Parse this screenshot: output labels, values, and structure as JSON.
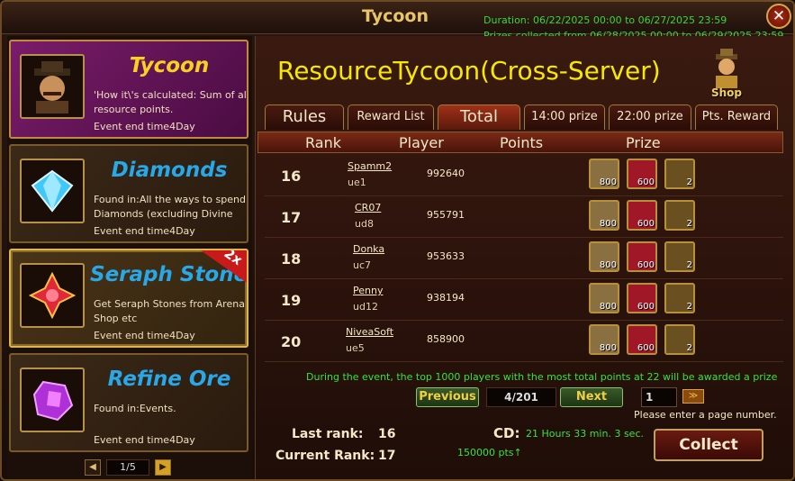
{
  "window": {
    "title": "Tycoon",
    "duration": "Duration: 06/22/2025 00:00 to 06/27/2025 23:59",
    "prizes_collected": "Prizes collected from 06/28/2025 00:00 to 06/29/2025 23:59",
    "close_label": "✕"
  },
  "sidebar": {
    "cards": [
      {
        "title": "Tycoon",
        "desc": "'How it\\'s calculated: Sum of all resource points.",
        "end": "Event end time4Day",
        "title_color": "#f8d020"
      },
      {
        "title": "Diamonds",
        "desc": "Found in:All the ways to spend Diamonds (excluding Divine",
        "end": "Event end time4Day",
        "title_color": "#28a8e8"
      },
      {
        "title": "Seraph Stones",
        "desc": "Get Seraph Stones from Arena Shop etc",
        "end": "Event end time4Day",
        "badge": "2x",
        "title_color": "#28a8e8"
      },
      {
        "title": "Refine Ore",
        "desc": "Found in:Events.",
        "end": "Event end time4Day",
        "title_color": "#28a8e8"
      }
    ],
    "pager": {
      "page": "1/5",
      "prev": "◀",
      "next": "▶"
    }
  },
  "main": {
    "title": "ResourceTycoon(Cross-Server)",
    "shop_label": "Shop",
    "tabs": [
      "Rules",
      "Reward List",
      "Total",
      "14:00 prize",
      "22:00 prize",
      "Pts. Reward"
    ],
    "columns": [
      "Rank",
      "Player",
      "Points",
      "Prize"
    ],
    "rows": [
      {
        "rank": "16",
        "name": "Spamm2",
        "server": "ue1",
        "points": "992640",
        "prizes": [
          "800",
          "600",
          "2"
        ]
      },
      {
        "rank": "17",
        "name": "CR07",
        "server": "ud8",
        "points": "955791",
        "prizes": [
          "800",
          "600",
          "2"
        ]
      },
      {
        "rank": "18",
        "name": "Donka",
        "server": "uc7",
        "points": "953633",
        "prizes": [
          "800",
          "600",
          "2"
        ]
      },
      {
        "rank": "19",
        "name": "Penny",
        "server": "ud12",
        "points": "938194",
        "prizes": [
          "800",
          "600",
          "2"
        ]
      },
      {
        "rank": "20",
        "name": "NiveaSoft",
        "server": "ue5",
        "points": "858900",
        "prizes": [
          "800",
          "600",
          "2"
        ]
      }
    ],
    "notice": "During the event, the top 1000 players with the most total points at 22 will be awarded a prize",
    "pager": {
      "previous": "Previous",
      "page": "4/201",
      "next": "Next",
      "input_value": "1",
      "go": "≫"
    },
    "hint": "Please enter a page number.",
    "last_rank_label": "Last rank:",
    "last_rank": "16",
    "current_rank_label": "Current Rank:",
    "current_rank": "17",
    "cd_label": "CD:",
    "cd_value": "21 Hours 33 min. 3 sec.",
    "pts_value": "150000 pts↑",
    "collect_label": "Collect"
  },
  "colors": {
    "accent_gold": "#f8e800",
    "notice_green": "#3ce03c",
    "frame_gold": "#b8903a"
  }
}
